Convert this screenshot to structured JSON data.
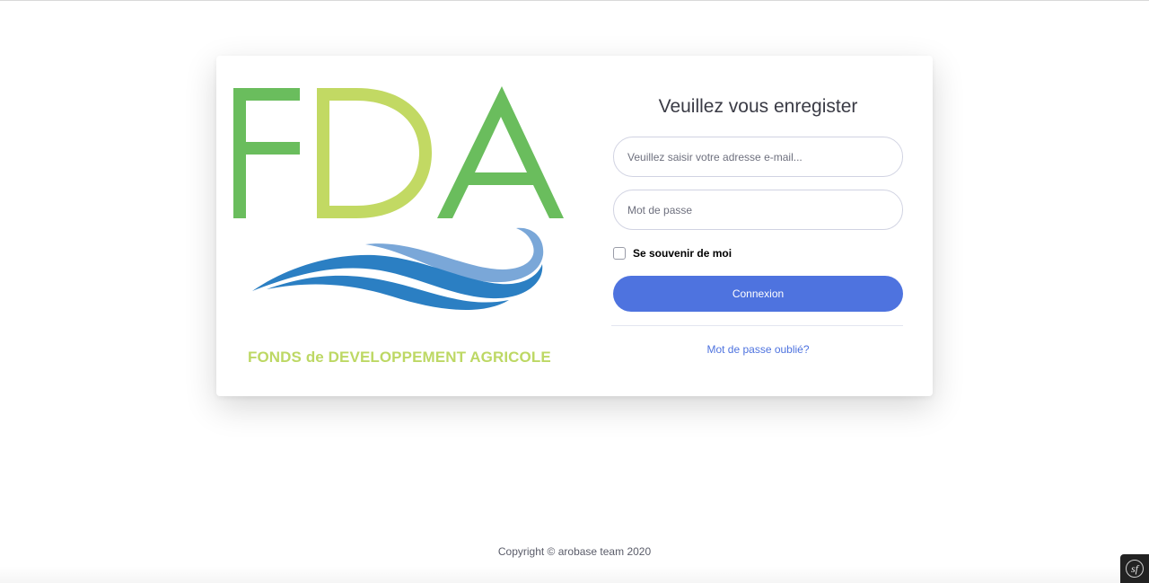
{
  "logo": {
    "letters": [
      "F",
      "D",
      "A"
    ],
    "tagline": "FONDS de DEVELOPPEMENT AGRICOLE",
    "colors": {
      "green": "#6abd5d",
      "lime": "#c2d963",
      "wave_dark": "#2b7fc3",
      "wave_light": "#7aa7d8",
      "tagline": "#bdd864"
    }
  },
  "login_form": {
    "title": "Veuillez vous enregister",
    "email_placeholder": "Veuillez saisir votre adresse e-mail...",
    "password_placeholder": "Mot de passe",
    "remember_label": "Se souvenir de moi",
    "remember_checked": false,
    "submit_label": "Connexion",
    "forgot_link": "Mot de passe oublié?"
  },
  "footer": {
    "copyright": "Copyright © arobase team 2020"
  },
  "debug_toolbar": {
    "icon": "symfony-logo-icon",
    "glyph": "sf"
  },
  "colors": {
    "primary": "#4e73df",
    "text_dark": "#3a3b45",
    "border": "#d1d3e2"
  }
}
